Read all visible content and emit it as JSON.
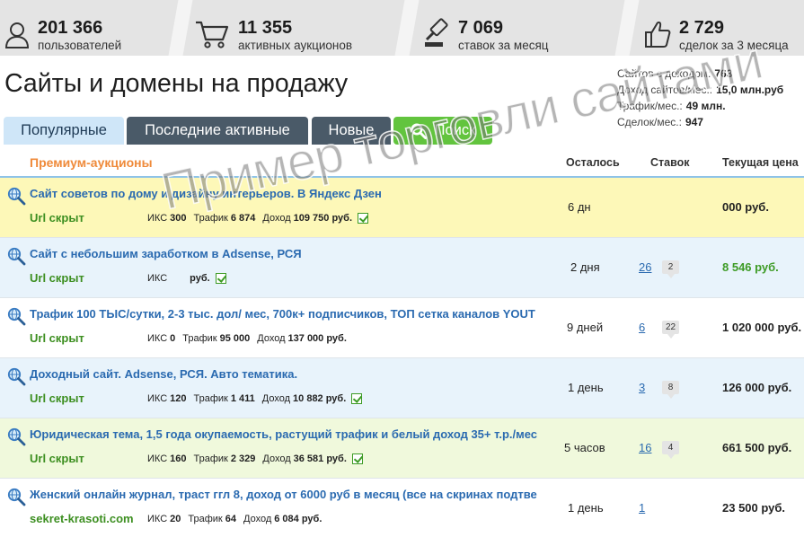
{
  "stats": [
    {
      "icon": "user-icon",
      "value": "201 366",
      "label": "пользователей"
    },
    {
      "icon": "cart-icon",
      "value": "11 355",
      "label": "активных аукционов"
    },
    {
      "icon": "gavel-icon",
      "value": "7 069",
      "label": "ставок за месяц"
    },
    {
      "icon": "thumbs-up-icon",
      "value": "2 729",
      "label": "сделок за 3 месяца"
    }
  ],
  "page_title": "Сайты и домены на продажу",
  "summary": [
    {
      "label": "Сайтов с доходом:",
      "value": "763"
    },
    {
      "label": "Доход сайтов/мес.:",
      "value": "15,0 млн.руб"
    },
    {
      "label": "Трафик/мес.:",
      "value": "49 млн."
    },
    {
      "label": "Сделок/мес.:",
      "value": "947"
    }
  ],
  "tabs": {
    "popular": "Популярные",
    "recent": "Последние активные",
    "new": "Новые",
    "search": "Поиск"
  },
  "table_header": {
    "premium": "Премиум-аукционы",
    "left": "Осталось",
    "bids": "Ставок",
    "price": "Текущая цена"
  },
  "rows": [
    {
      "title": "Сайт советов по дому и дизайну интерьеров. В Яндекс Дзен",
      "url": "Url скрыт",
      "iks_label": "ИКС",
      "iks": "300",
      "traffic_label": "Трафик",
      "traffic": "6 874",
      "income_label": "Доход",
      "income": "109 750 руб.",
      "left": "6 дн",
      "bids": "",
      "comments": "",
      "price": "000 руб.",
      "verified": true,
      "bg": "#fdf8b8"
    },
    {
      "title": "Сайт с небольшим заработком в Adsense, РСЯ",
      "url": "Url скрыт",
      "iks_label": "ИКС",
      "iks": "",
      "traffic_label": "",
      "traffic": "",
      "income_label": "",
      "income": "руб.",
      "left": "2 дня",
      "bids": "26",
      "comments": "2",
      "price": "8 546 руб.",
      "verified": true,
      "bg": "#e8f3fb"
    },
    {
      "title": "Трафик 100 ТЫС/сутки, 2-3 тыс. дол/ мес, 700к+ подписчиков, ТОП сетка каналов YOUT",
      "url": "Url скрыт",
      "iks_label": "ИКС",
      "iks": "0",
      "traffic_label": "Трафик",
      "traffic": "95 000",
      "income_label": "Доход",
      "income": "137 000 руб.",
      "left": "9 дней",
      "bids": "6",
      "comments": "22",
      "price": "1 020 000 руб.",
      "verified": false,
      "bg": "#ffffff"
    },
    {
      "title": "Доходный сайт. Adsense, РСЯ. Авто тематика.",
      "url": "Url скрыт",
      "iks_label": "ИКС",
      "iks": "120",
      "traffic_label": "Трафик",
      "traffic": "1 411",
      "income_label": "Доход",
      "income": "10 882 руб.",
      "left": "1 день",
      "bids": "3",
      "comments": "8",
      "price": "126 000 руб.",
      "verified": true,
      "bg": "#e8f3fb"
    },
    {
      "title": "Юридическая тема, 1,5 года окупаемость, растущий трафик и белый доход 35+ т.р./мес",
      "url": "Url скрыт",
      "iks_label": "ИКС",
      "iks": "160",
      "traffic_label": "Трафик",
      "traffic": "2 329",
      "income_label": "Доход",
      "income": "36 581 руб.",
      "left": "5 часов",
      "bids": "16",
      "comments": "4",
      "price": "661 500 руб.",
      "verified": true,
      "bg": "#f0f9dc"
    },
    {
      "title": "Женский онлайн журнал, траст ггл 8, доход от 6000 руб в месяц (все на скринах подтве",
      "url": "sekret-krasoti.com",
      "iks_label": "ИКС",
      "iks": "20",
      "traffic_label": "Трафик",
      "traffic": "64",
      "income_label": "Доход",
      "income": "6 084 руб.",
      "left": "1 день",
      "bids": "1",
      "comments": "",
      "price": "23 500 руб.",
      "verified": false,
      "bg": "#ffffff"
    }
  ],
  "watermark": "Пример торговли сайтами"
}
